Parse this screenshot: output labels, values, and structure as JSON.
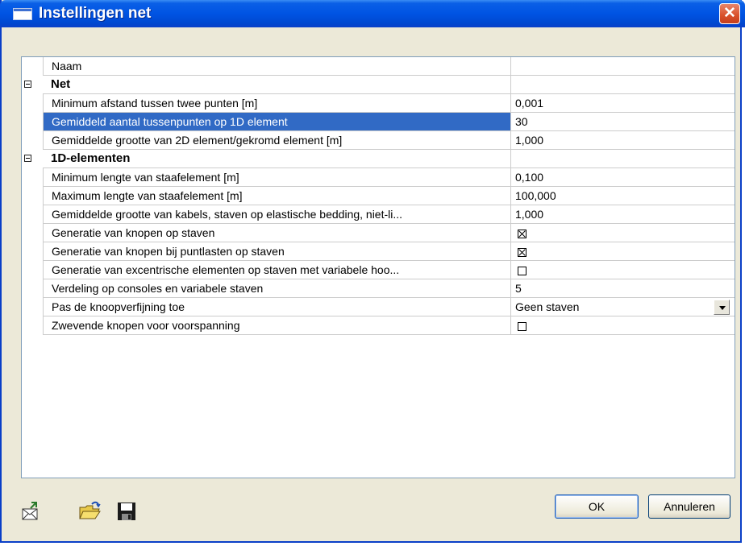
{
  "window": {
    "title": "Instellingen net",
    "close_symbol": "✕"
  },
  "grid": {
    "header_label": "Naam",
    "rows": [
      {
        "kind": "category",
        "label": "Net"
      },
      {
        "kind": "item",
        "label": "Minimum afstand tussen twee punten [m]",
        "value": "0,001"
      },
      {
        "kind": "item",
        "label": "Gemiddeld aantal tussenpunten op 1D element",
        "value": "30",
        "selected": true
      },
      {
        "kind": "item",
        "label": "Gemiddelde grootte van 2D element/gekromd element [m]",
        "value": "1,000"
      },
      {
        "kind": "category",
        "label": "1D-elementen"
      },
      {
        "kind": "item",
        "label": "Minimum lengte van staafelement [m]",
        "value": "0,100"
      },
      {
        "kind": "item",
        "label": "Maximum lengte van staafelement [m]",
        "value": "100,000"
      },
      {
        "kind": "item",
        "label": "Gemiddelde grootte van kabels, staven op elastische bedding, niet-li...",
        "value": "1,000"
      },
      {
        "kind": "item",
        "label": "Generatie van knopen op staven",
        "checkbox": true,
        "checked": true
      },
      {
        "kind": "item",
        "label": "Generatie van knopen bij puntlasten op staven",
        "checkbox": true,
        "checked": true
      },
      {
        "kind": "item",
        "label": "Generatie van excentrische elementen op staven met variabele hoo...",
        "checkbox": true,
        "checked": false
      },
      {
        "kind": "item",
        "label": "Verdeling op consoles en variabele staven",
        "value": "5"
      },
      {
        "kind": "item",
        "label": "Pas de knoopverfijning toe",
        "value": "Geen staven",
        "dropdown": true
      },
      {
        "kind": "item",
        "label": "Zwevende knopen voor voorspanning",
        "checkbox": true,
        "checked": false
      }
    ]
  },
  "buttons": {
    "ok": "OK",
    "cancel": "Annuleren"
  },
  "colors": {
    "selection": "#316ac5",
    "titlebar": "#0054e3",
    "close": "#d9502a"
  }
}
